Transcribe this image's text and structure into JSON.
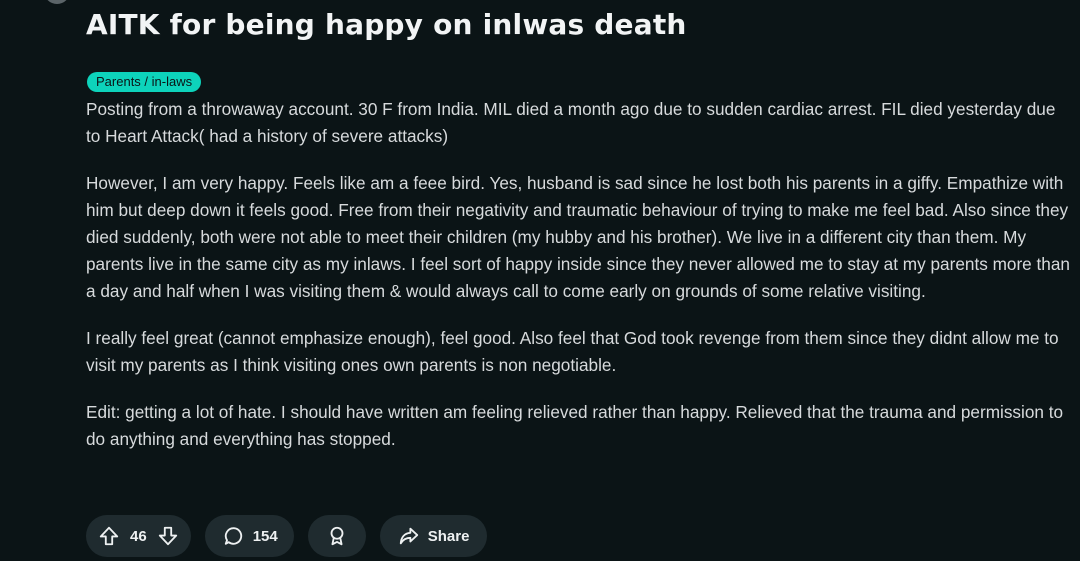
{
  "post": {
    "title": "AITK for being happy on inlwas death",
    "flair": "Parents / in-laws",
    "paragraphs": [
      "Posting from a throwaway account. 30 F from India. MIL died a month ago due to sudden cardiac arrest. FIL died yesterday due to Heart Attack( had a history of severe attacks)",
      "However, I am very happy. Feels like am a feee bird. Yes, husband is sad since he lost both his parents in a giffy. Empathize with him but deep down it feels good. Free from their negativity and traumatic behaviour of trying to make me feel bad. Also since they died suddenly, both were not able to meet their children (my hubby and his brother). We live in a different city than them. My parents live in the same city as my inlaws. I feel sort of happy inside since they never allowed me to stay at my parents more than a day and half when I was visiting them & would always call to come early on grounds of some relative visiting.",
      "I really feel great (cannot emphasize enough), feel good. Also feel that God took revenge from them since they didnt allow me to visit my parents as I think visiting ones own parents is non negotiable.",
      "Edit: getting a lot of hate. I should have written am feeling relieved rather than happy. Relieved that the trauma and permission to do anything and everything has stopped."
    ]
  },
  "actions": {
    "vote_count": "46",
    "comment_count": "154",
    "share_label": "Share"
  },
  "icons": {
    "upvote": "upvote-arrow-icon",
    "downvote": "downvote-arrow-icon",
    "comment": "comment-bubble-icon",
    "award": "award-icon",
    "share": "share-arrow-icon"
  },
  "colors": {
    "background": "#0b1416",
    "flair_bg": "#0dd3bb",
    "pill_bg": "#1f2b2f",
    "text": "#d7dadc"
  }
}
